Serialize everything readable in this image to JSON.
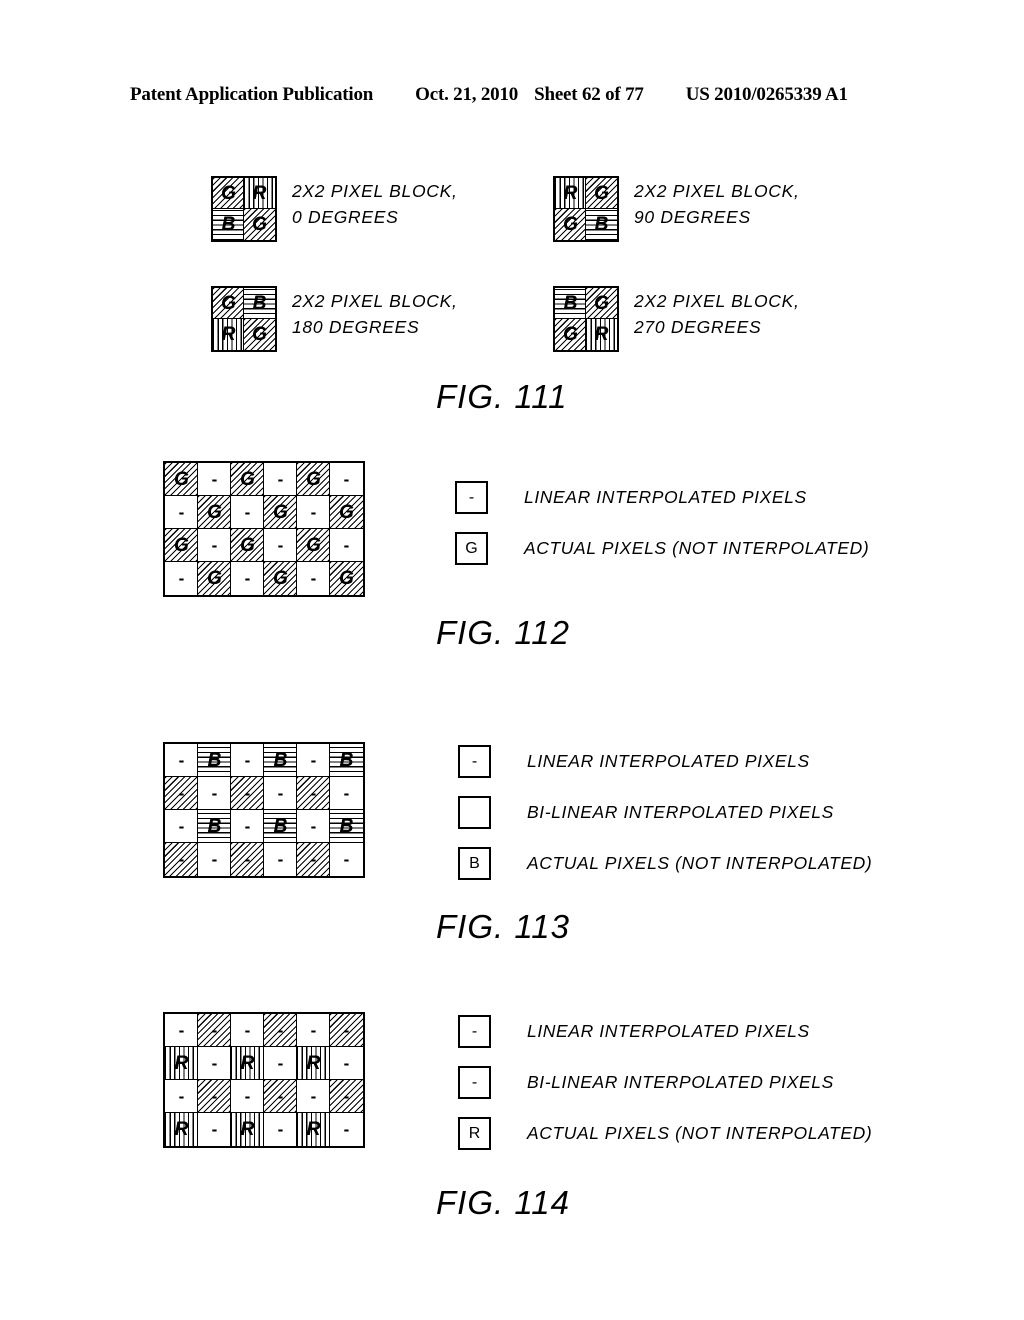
{
  "header": {
    "publication": "Patent Application Publication",
    "date": "Oct. 21, 2010",
    "sheet": "Sheet 62 of 77",
    "number": "US 2010/0265339 A1"
  },
  "figures": [
    {
      "id": "fig111",
      "caption": "FIG. 111",
      "blocks": [
        {
          "label_line1": "2X2 PIXEL BLOCK,",
          "label_line2": "0 DEGREES",
          "cells": [
            {
              "glyph": "G",
              "pattern": "diag"
            },
            {
              "glyph": "R",
              "pattern": "vert"
            },
            {
              "glyph": "B",
              "pattern": "horiz"
            },
            {
              "glyph": "G",
              "pattern": "diag"
            }
          ]
        },
        {
          "label_line1": "2X2 PIXEL BLOCK,",
          "label_line2": "90 DEGREES",
          "cells": [
            {
              "glyph": "R",
              "pattern": "vert"
            },
            {
              "glyph": "G",
              "pattern": "diag"
            },
            {
              "glyph": "G",
              "pattern": "diag"
            },
            {
              "glyph": "B",
              "pattern": "horiz"
            }
          ]
        },
        {
          "label_line1": "2X2 PIXEL BLOCK,",
          "label_line2": "180 DEGREES",
          "cells": [
            {
              "glyph": "G",
              "pattern": "diag"
            },
            {
              "glyph": "B",
              "pattern": "horiz"
            },
            {
              "glyph": "R",
              "pattern": "vert"
            },
            {
              "glyph": "G",
              "pattern": "diag"
            }
          ]
        },
        {
          "label_line1": "2X2 PIXEL BLOCK,",
          "label_line2": "270 DEGREES",
          "cells": [
            {
              "glyph": "B",
              "pattern": "horiz"
            },
            {
              "glyph": "G",
              "pattern": "diag"
            },
            {
              "glyph": "G",
              "pattern": "diag"
            },
            {
              "glyph": "R",
              "pattern": "vert"
            }
          ]
        }
      ]
    },
    {
      "id": "fig112",
      "caption": "FIG. 112",
      "grid": {
        "cols": 6,
        "rows": 4,
        "cells": [
          [
            {
              "glyph": "G",
              "pattern": "diag"
            },
            {
              "glyph": "-",
              "pattern": "none"
            },
            {
              "glyph": "G",
              "pattern": "diag"
            },
            {
              "glyph": "-",
              "pattern": "none"
            },
            {
              "glyph": "G",
              "pattern": "diag"
            },
            {
              "glyph": "-",
              "pattern": "none"
            }
          ],
          [
            {
              "glyph": "-",
              "pattern": "none"
            },
            {
              "glyph": "G",
              "pattern": "diag"
            },
            {
              "glyph": "-",
              "pattern": "none"
            },
            {
              "glyph": "G",
              "pattern": "diag"
            },
            {
              "glyph": "-",
              "pattern": "none"
            },
            {
              "glyph": "G",
              "pattern": "diag"
            }
          ],
          [
            {
              "glyph": "G",
              "pattern": "diag"
            },
            {
              "glyph": "-",
              "pattern": "none"
            },
            {
              "glyph": "G",
              "pattern": "diag"
            },
            {
              "glyph": "-",
              "pattern": "none"
            },
            {
              "glyph": "G",
              "pattern": "diag"
            },
            {
              "glyph": "-",
              "pattern": "none"
            }
          ],
          [
            {
              "glyph": "-",
              "pattern": "none"
            },
            {
              "glyph": "G",
              "pattern": "diag"
            },
            {
              "glyph": "-",
              "pattern": "none"
            },
            {
              "glyph": "G",
              "pattern": "diag"
            },
            {
              "glyph": "-",
              "pattern": "none"
            },
            {
              "glyph": "G",
              "pattern": "diag"
            }
          ]
        ]
      },
      "legend": [
        {
          "glyph": "-",
          "pattern": "none",
          "text": "LINEAR INTERPOLATED PIXELS"
        },
        {
          "glyph": "G",
          "pattern": "diag",
          "text": "ACTUAL PIXELS (NOT INTERPOLATED)"
        }
      ]
    },
    {
      "id": "fig113",
      "caption": "FIG. 113",
      "grid": {
        "cols": 6,
        "rows": 4,
        "cells": [
          [
            {
              "glyph": "-",
              "pattern": "none"
            },
            {
              "glyph": "B",
              "pattern": "horiz"
            },
            {
              "glyph": "-",
              "pattern": "none"
            },
            {
              "glyph": "B",
              "pattern": "horiz"
            },
            {
              "glyph": "-",
              "pattern": "none"
            },
            {
              "glyph": "B",
              "pattern": "horiz"
            }
          ],
          [
            {
              "glyph": "-",
              "pattern": "diag"
            },
            {
              "glyph": "-",
              "pattern": "none"
            },
            {
              "glyph": "-",
              "pattern": "diag"
            },
            {
              "glyph": "-",
              "pattern": "none"
            },
            {
              "glyph": "-",
              "pattern": "diag"
            },
            {
              "glyph": "-",
              "pattern": "none"
            }
          ],
          [
            {
              "glyph": "-",
              "pattern": "none"
            },
            {
              "glyph": "B",
              "pattern": "horiz"
            },
            {
              "glyph": "-",
              "pattern": "none"
            },
            {
              "glyph": "B",
              "pattern": "horiz"
            },
            {
              "glyph": "-",
              "pattern": "none"
            },
            {
              "glyph": "B",
              "pattern": "horiz"
            }
          ],
          [
            {
              "glyph": "-",
              "pattern": "diag"
            },
            {
              "glyph": "-",
              "pattern": "none"
            },
            {
              "glyph": "-",
              "pattern": "diag"
            },
            {
              "glyph": "-",
              "pattern": "none"
            },
            {
              "glyph": "-",
              "pattern": "diag"
            },
            {
              "glyph": "-",
              "pattern": "none"
            }
          ]
        ]
      },
      "legend": [
        {
          "glyph": "-",
          "pattern": "none",
          "text": "LINEAR INTERPOLATED PIXELS"
        },
        {
          "glyph": "",
          "pattern": "diag",
          "text": "BI-LINEAR INTERPOLATED PIXELS"
        },
        {
          "glyph": "B",
          "pattern": "horiz",
          "text": "ACTUAL PIXELS (NOT INTERPOLATED)"
        }
      ]
    },
    {
      "id": "fig114",
      "caption": "FIG. 114",
      "grid": {
        "cols": 6,
        "rows": 4,
        "cells": [
          [
            {
              "glyph": "-",
              "pattern": "none"
            },
            {
              "glyph": "-",
              "pattern": "diag"
            },
            {
              "glyph": "-",
              "pattern": "none"
            },
            {
              "glyph": "-",
              "pattern": "diag"
            },
            {
              "glyph": "-",
              "pattern": "none"
            },
            {
              "glyph": "-",
              "pattern": "diag"
            }
          ],
          [
            {
              "glyph": "R",
              "pattern": "vert"
            },
            {
              "glyph": "-",
              "pattern": "none"
            },
            {
              "glyph": "R",
              "pattern": "vert"
            },
            {
              "glyph": "-",
              "pattern": "none"
            },
            {
              "glyph": "R",
              "pattern": "vert"
            },
            {
              "glyph": "-",
              "pattern": "none"
            }
          ],
          [
            {
              "glyph": "-",
              "pattern": "none"
            },
            {
              "glyph": "-",
              "pattern": "diag"
            },
            {
              "glyph": "-",
              "pattern": "none"
            },
            {
              "glyph": "-",
              "pattern": "diag"
            },
            {
              "glyph": "-",
              "pattern": "none"
            },
            {
              "glyph": "-",
              "pattern": "diag"
            }
          ],
          [
            {
              "glyph": "R",
              "pattern": "vert"
            },
            {
              "glyph": "-",
              "pattern": "none"
            },
            {
              "glyph": "R",
              "pattern": "vert"
            },
            {
              "glyph": "-",
              "pattern": "none"
            },
            {
              "glyph": "R",
              "pattern": "vert"
            },
            {
              "glyph": "-",
              "pattern": "none"
            }
          ]
        ]
      },
      "legend": [
        {
          "glyph": "-",
          "pattern": "none",
          "text": "LINEAR INTERPOLATED PIXELS"
        },
        {
          "glyph": "-",
          "pattern": "diag",
          "text": "BI-LINEAR INTERPOLATED PIXELS"
        },
        {
          "glyph": "R",
          "pattern": "vert",
          "text": "ACTUAL PIXELS (NOT INTERPOLATED)"
        }
      ]
    }
  ]
}
